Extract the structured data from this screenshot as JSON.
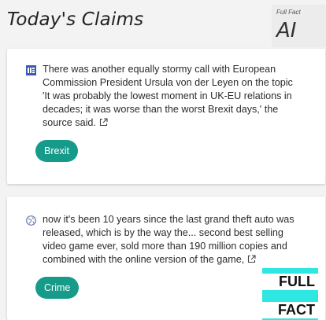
{
  "header": {
    "title": "Today's Claims",
    "brand_small": "Full Fact",
    "brand_big": "AI"
  },
  "claims": [
    {
      "source_icon": "news-source-icon",
      "text": "There was another equally stormy call with European Commission President Ursula von der Leyen on the topic 'It was probably the lowest moment in UK-EU relations in decades; it was worse than the worst Brexit days,' the source said.",
      "tag": "Brexit"
    },
    {
      "source_icon": "globe-icon",
      "text": "now it's been 10 years since the last grand theft auto was released, which is by the way the... second best selling video game ever, sold more than 190 million copies and combined with the online version of the game,",
      "tag": "Crime"
    }
  ],
  "logo": {
    "line1": "FULL",
    "line2": "FACT"
  },
  "colors": {
    "tag": "#169b8a",
    "logo_accent": "#2ee6e2",
    "source_icon_blue": "#3b5bb5"
  }
}
